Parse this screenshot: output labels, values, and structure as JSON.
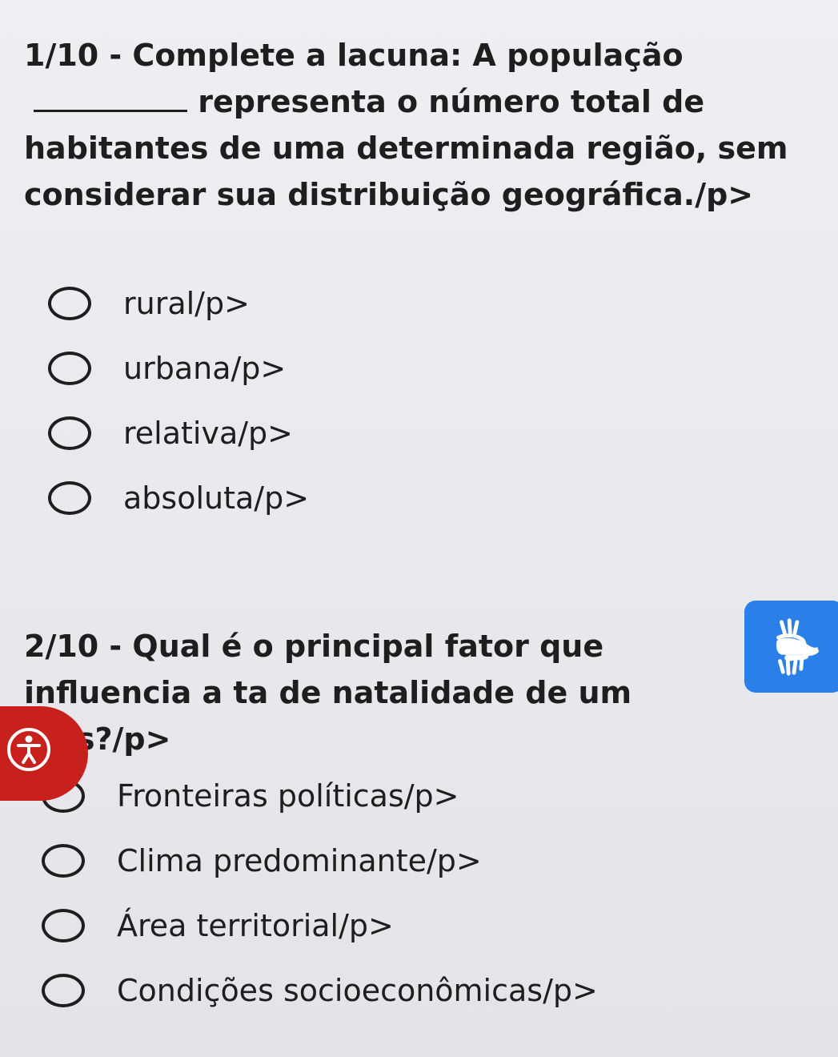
{
  "questions": [
    {
      "text_before": "1/10 - Complete a lacuna: A população",
      "text_after": "representa o número total de habitantes de uma determinada região, sem considerar sua distribuição geográfica./p>",
      "options": [
        {
          "label": "rural/p>"
        },
        {
          "label": "urbana/p>"
        },
        {
          "label": "relativa/p>"
        },
        {
          "label": "absoluta/p>"
        }
      ]
    },
    {
      "text": "2/10 - Qual é o principal fator que influencia a ta de natalidade de um país?/p>",
      "options": [
        {
          "label": "Fronteiras políticas/p>"
        },
        {
          "label": "Clima predominante/p>"
        },
        {
          "label": "Área territorial/p>"
        },
        {
          "label": "Condições socioeconômicas/p>"
        }
      ]
    }
  ],
  "widgets": {
    "libras_icon": "sign-language-hands-icon",
    "accessibility_icon": "accessibility-person-icon"
  },
  "colors": {
    "background": "#ececf0",
    "text": "#1e1e1e",
    "libras_blue": "#2a7fe8",
    "accessibility_red": "#c8201c"
  }
}
